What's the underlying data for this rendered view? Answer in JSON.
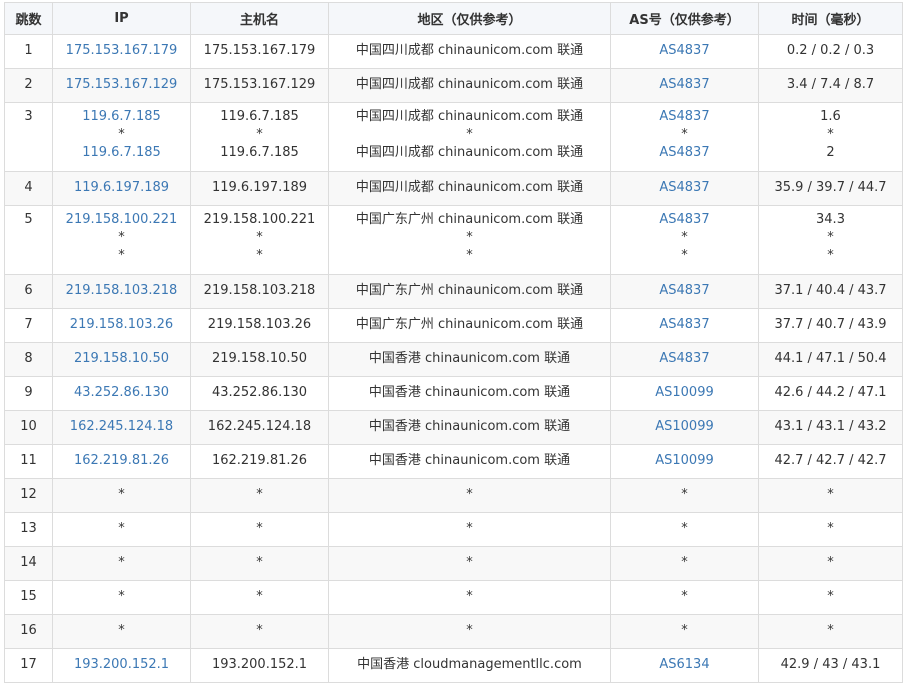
{
  "headers": {
    "hop": "跳数",
    "ip": "IP",
    "host": "主机名",
    "area": "地区（仅供参考）",
    "as": "AS号（仅供参考）",
    "time": "时间（毫秒）"
  },
  "rows": [
    {
      "hop": "1",
      "ip": [
        "175.153.167.179"
      ],
      "host": [
        "175.153.167.179"
      ],
      "area": [
        "中国四川成都 chinaunicom.com 联通"
      ],
      "as": [
        "AS4837"
      ],
      "time": [
        "0.2 / 0.2 / 0.3"
      ]
    },
    {
      "hop": "2",
      "ip": [
        "175.153.167.129"
      ],
      "host": [
        "175.153.167.129"
      ],
      "area": [
        "中国四川成都 chinaunicom.com 联通"
      ],
      "as": [
        "AS4837"
      ],
      "time": [
        "3.4 / 7.4 / 8.7"
      ]
    },
    {
      "hop": "3",
      "ip": [
        "119.6.7.185",
        "*",
        "119.6.7.185"
      ],
      "host": [
        "119.6.7.185",
        "*",
        "119.6.7.185"
      ],
      "area": [
        "中国四川成都 chinaunicom.com 联通",
        "*",
        "中国四川成都 chinaunicom.com 联通"
      ],
      "as": [
        "AS4837",
        "*",
        "AS4837"
      ],
      "time": [
        "1.6",
        "*",
        "2"
      ]
    },
    {
      "hop": "4",
      "ip": [
        "119.6.197.189"
      ],
      "host": [
        "119.6.197.189"
      ],
      "area": [
        "中国四川成都 chinaunicom.com 联通"
      ],
      "as": [
        "AS4837"
      ],
      "time": [
        "35.9 / 39.7 / 44.7"
      ]
    },
    {
      "hop": "5",
      "ip": [
        "219.158.100.221",
        "*",
        "*"
      ],
      "host": [
        "219.158.100.221",
        "*",
        "*"
      ],
      "area": [
        "中国广东广州 chinaunicom.com 联通",
        "*",
        "*"
      ],
      "as": [
        "AS4837",
        "*",
        "*"
      ],
      "time": [
        "34.3",
        "*",
        "*"
      ]
    },
    {
      "hop": "6",
      "ip": [
        "219.158.103.218"
      ],
      "host": [
        "219.158.103.218"
      ],
      "area": [
        "中国广东广州 chinaunicom.com 联通"
      ],
      "as": [
        "AS4837"
      ],
      "time": [
        "37.1 / 40.4 / 43.7"
      ]
    },
    {
      "hop": "7",
      "ip": [
        "219.158.103.26"
      ],
      "host": [
        "219.158.103.26"
      ],
      "area": [
        "中国广东广州 chinaunicom.com 联通"
      ],
      "as": [
        "AS4837"
      ],
      "time": [
        "37.7 / 40.7 / 43.9"
      ]
    },
    {
      "hop": "8",
      "ip": [
        "219.158.10.50"
      ],
      "host": [
        "219.158.10.50"
      ],
      "area": [
        "中国香港 chinaunicom.com 联通"
      ],
      "as": [
        "AS4837"
      ],
      "time": [
        "44.1 / 47.1 / 50.4"
      ]
    },
    {
      "hop": "9",
      "ip": [
        "43.252.86.130"
      ],
      "host": [
        "43.252.86.130"
      ],
      "area": [
        "中国香港 chinaunicom.com 联通"
      ],
      "as": [
        "AS10099"
      ],
      "time": [
        "42.6 / 44.2 / 47.1"
      ]
    },
    {
      "hop": "10",
      "ip": [
        "162.245.124.18"
      ],
      "host": [
        "162.245.124.18"
      ],
      "area": [
        "中国香港 chinaunicom.com 联通"
      ],
      "as": [
        "AS10099"
      ],
      "time": [
        "43.1 / 43.1 / 43.2"
      ]
    },
    {
      "hop": "11",
      "ip": [
        "162.219.81.26"
      ],
      "host": [
        "162.219.81.26"
      ],
      "area": [
        "中国香港 chinaunicom.com 联通"
      ],
      "as": [
        "AS10099"
      ],
      "time": [
        "42.7 / 42.7 / 42.7"
      ]
    },
    {
      "hop": "12",
      "ip": [
        "*"
      ],
      "host": [
        "*"
      ],
      "area": [
        "*"
      ],
      "as": [
        "*"
      ],
      "time": [
        "*"
      ]
    },
    {
      "hop": "13",
      "ip": [
        "*"
      ],
      "host": [
        "*"
      ],
      "area": [
        "*"
      ],
      "as": [
        "*"
      ],
      "time": [
        "*"
      ]
    },
    {
      "hop": "14",
      "ip": [
        "*"
      ],
      "host": [
        "*"
      ],
      "area": [
        "*"
      ],
      "as": [
        "*"
      ],
      "time": [
        "*"
      ]
    },
    {
      "hop": "15",
      "ip": [
        "*"
      ],
      "host": [
        "*"
      ],
      "area": [
        "*"
      ],
      "as": [
        "*"
      ],
      "time": [
        "*"
      ]
    },
    {
      "hop": "16",
      "ip": [
        "*"
      ],
      "host": [
        "*"
      ],
      "area": [
        "*"
      ],
      "as": [
        "*"
      ],
      "time": [
        "*"
      ]
    },
    {
      "hop": "17",
      "ip": [
        "193.200.152.1"
      ],
      "host": [
        "193.200.152.1"
      ],
      "area": [
        "中国香港 cloudmanagementllc.com"
      ],
      "as": [
        "AS6134"
      ],
      "time": [
        "42.9 / 43 / 43.1"
      ]
    }
  ],
  "colors": {
    "link": "#3c78b4",
    "text": "#333333",
    "border": "#dcdcdc",
    "header_bg": "#f5f7fa",
    "stripe_bg": "#f8f8f8"
  }
}
